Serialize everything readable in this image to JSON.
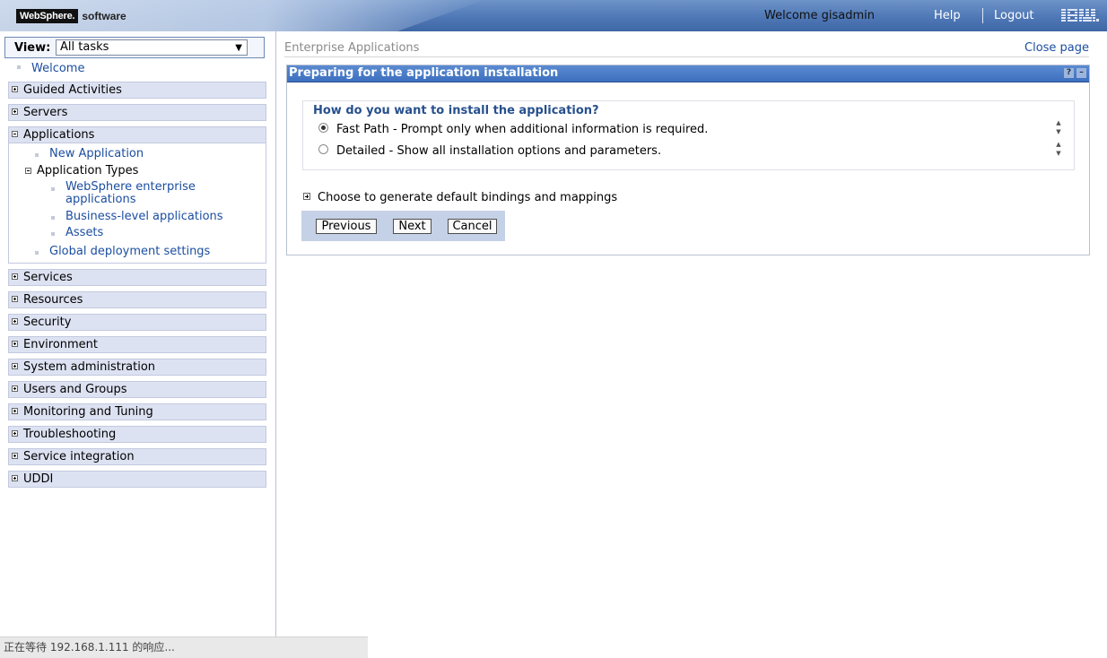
{
  "header": {
    "brand_main": "WebSphere.",
    "brand_sub": "software",
    "welcome": "Welcome gisadmin",
    "help": "Help",
    "logout": "Logout",
    "ibm": "IBM."
  },
  "nav": {
    "view_label": "View:",
    "view_value": "All tasks",
    "welcome": "Welcome",
    "categories": {
      "guided": "Guided Activities",
      "servers": "Servers",
      "applications": "Applications",
      "services": "Services",
      "resources": "Resources",
      "security": "Security",
      "environment": "Environment",
      "sysadmin": "System administration",
      "users": "Users and Groups",
      "monitoring": "Monitoring and Tuning",
      "troubleshooting": "Troubleshooting",
      "service_integration": "Service integration",
      "uddi": "UDDI"
    },
    "apps": {
      "new_application": "New Application",
      "application_types": "Application Types",
      "websphere_enterprise_1": "WebSphere enterprise",
      "websphere_enterprise_2": "applications",
      "business_level": "Business-level applications",
      "assets": "Assets",
      "global_deployment": "Global deployment settings"
    }
  },
  "status_bar": "正在等待 192.168.1.111 的响应...",
  "main": {
    "breadcrumb": "Enterprise Applications",
    "close_page": "Close page",
    "panel_title": "Preparing for the application installation",
    "question": "How do you want to install the application?",
    "option_fast": "Fast Path - Prompt only when additional information is required.",
    "option_detailed": "Detailed - Show all installation options and parameters.",
    "selected_option": "fast",
    "bindings_label": "Choose to generate default bindings and mappings",
    "buttons": {
      "previous": "Previous",
      "next": "Next",
      "cancel": "Cancel"
    }
  }
}
